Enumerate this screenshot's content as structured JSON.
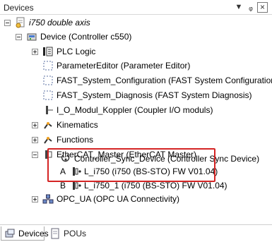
{
  "window": {
    "title": "Devices"
  },
  "tree": {
    "project": "i750 double axis",
    "device": "Device (Controller c550)",
    "items": {
      "plc_logic": "PLC Logic",
      "parameter_editor": "ParameterEditor (Parameter Editor)",
      "fast_config": "FAST_System_Configuration (FAST System Configuration)",
      "fast_diag": "FAST_System_Diagnosis (FAST System Diagnosis)",
      "io_module": "I_O_Modul_Koppler (Coupler I/O moduls)",
      "kinematics": "Kinematics",
      "functions": "Functions",
      "ethercat": "EtherCAT_Master (EtherCAT Master)",
      "sync_device": "Controller_Sync_Device (Controller Sync Device)",
      "axis_a": "L_i750 (i750 (BS-STO) FW V01.04)",
      "axis_b": "L_i750_1 (i750 (BS-STO) FW V01.04)",
      "opc_ua": "OPC_UA (OPC UA Connectivity)"
    },
    "markers": {
      "a": "A",
      "b": "B"
    }
  },
  "tabs": [
    {
      "label": "Devices",
      "active": true
    },
    {
      "label": "POUs",
      "active": false
    }
  ],
  "colors": {
    "highlight": "#d42424"
  }
}
